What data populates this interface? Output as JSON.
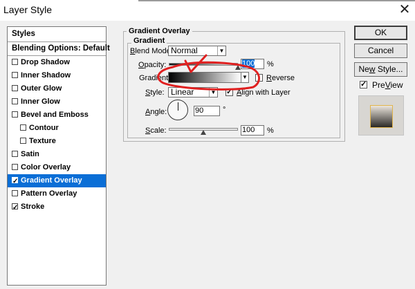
{
  "window": {
    "title": "Layer Style",
    "close_glyph": "✕"
  },
  "styles_panel": {
    "header": "Styles",
    "blending": "Blending Options: Default",
    "items": [
      {
        "label": "Drop Shadow",
        "checked": false
      },
      {
        "label": "Inner Shadow",
        "checked": false
      },
      {
        "label": "Outer Glow",
        "checked": false
      },
      {
        "label": "Inner Glow",
        "checked": false
      },
      {
        "label": "Bevel and Emboss",
        "checked": false
      },
      {
        "label": "Contour",
        "checked": false
      },
      {
        "label": "Texture",
        "checked": false
      },
      {
        "label": "Satin",
        "checked": false
      },
      {
        "label": "Color Overlay",
        "checked": false
      },
      {
        "label": "Gradient Overlay",
        "checked": true,
        "selected": true
      },
      {
        "label": "Pattern Overlay",
        "checked": false
      },
      {
        "label": "Stroke",
        "checked": true
      }
    ]
  },
  "gradient_overlay": {
    "group_title": "Gradient Overlay",
    "subgroup_title": "Gradient",
    "blend_mode": {
      "label_u": "B",
      "label_rest": "lend Mode:",
      "value": "Normal"
    },
    "opacity": {
      "label_u": "O",
      "label_rest": "pacity:",
      "value": "100",
      "unit": "%",
      "level": 1.0
    },
    "gradient": {
      "label": "Gradient:",
      "from_color": "#000000",
      "to_color": "#ffffff"
    },
    "reverse": {
      "label_u": "R",
      "label_rest": "everse",
      "checked": false
    },
    "style": {
      "label_u": "S",
      "label_rest": "tyle:",
      "value": "Linear"
    },
    "align_with_layer": {
      "label_u": "A",
      "label_rest": "lign with Layer",
      "checked": true
    },
    "angle": {
      "label_u": "A",
      "label_rest": "ngle:",
      "value": "90",
      "unit": "°"
    },
    "scale": {
      "label_u": "S",
      "label_rest": "cale:",
      "value": "100",
      "unit": "%",
      "level": 0.5
    }
  },
  "buttons": {
    "ok": "OK",
    "cancel": "Cancel",
    "new_style_pre": "Ne",
    "new_style_u": "w",
    "new_style_post": " Style...",
    "preview_u": "V",
    "preview_pre": "Pre",
    "preview_post": "iew",
    "preview_checked": true
  },
  "colors": {
    "selection": "#0a6ed6",
    "annotation": "#e02020",
    "preview_border": "#e1b44a"
  }
}
